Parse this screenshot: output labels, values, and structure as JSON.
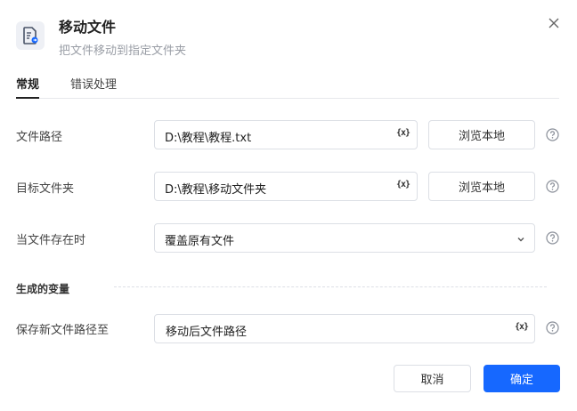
{
  "header": {
    "title": "移动文件",
    "subtitle": "把文件移动到指定文件夹"
  },
  "tabs": [
    {
      "label": "常规",
      "active": true
    },
    {
      "label": "错误处理",
      "active": false
    }
  ],
  "form": {
    "file_path": {
      "label": "文件路径",
      "value": "D:\\教程\\教程.txt",
      "browse_label": "浏览本地"
    },
    "target_folder": {
      "label": "目标文件夹",
      "value": "D:\\教程\\移动文件夹",
      "browse_label": "浏览本地"
    },
    "when_exists": {
      "label": "当文件存在时",
      "value": "覆盖原有文件"
    }
  },
  "output_section": {
    "title": "生成的变量",
    "save_path": {
      "label": "保存新文件路径至",
      "value": "移动后文件路径"
    }
  },
  "variable_icon_text": "{x}",
  "footer": {
    "cancel_label": "取消",
    "ok_label": "确定"
  },
  "colors": {
    "primary": "#1668ff"
  }
}
